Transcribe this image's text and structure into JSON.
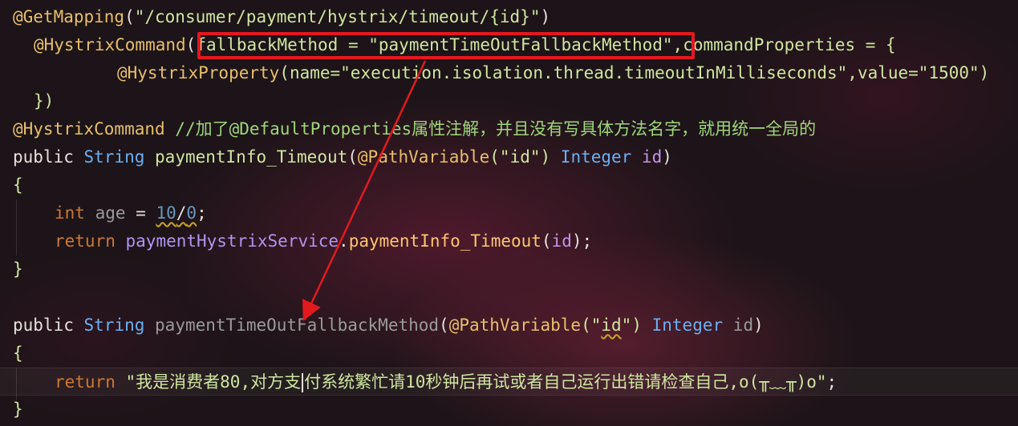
{
  "code": {
    "line1": {
      "annotation": "@GetMapping",
      "open": "(",
      "path": "\"/consumer/payment/hystrix/timeout/{id}\"",
      "close": ")"
    },
    "line2": {
      "annotation": "@HystrixCommand",
      "open": "(",
      "fallback": "fallbackMethod = \"paymentTimeOutFallbackMethod\"",
      "rest": ",commandProperties = {"
    },
    "line3": {
      "annotation": "@HystrixProperty",
      "args": "(name=\"execution.isolation.thread.timeoutInMilliseconds\",value=\"1500\")"
    },
    "line4": {
      "text": "})"
    },
    "line5": {
      "annotation": "@HystrixCommand",
      "comment": " //加了@DefaultProperties属性注解，并且没有写具体方法名字，就用统一全局的"
    },
    "line6": {
      "kw_public": "public",
      "type_string": "String",
      "method": "paymentInfo_Timeout",
      "open": "(",
      "param_ann": "@PathVariable",
      "param_str": "(\"id\")",
      "param_type": "Integer",
      "param_name": "id",
      "close": ")"
    },
    "line7": {
      "text": "{"
    },
    "line8": {
      "kw_int": "int",
      "var": "age",
      "eq": " = ",
      "num1": "10",
      "slash": "/",
      "num2": "0",
      "semi": ";"
    },
    "line9": {
      "kw_return": "return",
      "service": "paymentHystrixService",
      "dot": ".",
      "call": "paymentInfo_Timeout",
      "open": "(",
      "arg": "id",
      "close": ");"
    },
    "line10": {
      "text": "}"
    },
    "line12": {
      "kw_public": "public",
      "type_string": "String",
      "method": "paymentTimeOutFallbackMethod",
      "open": "(",
      "param_ann": "@PathVariable",
      "param_str_a": "(\"",
      "param_str_id": "id",
      "param_str_b": "\")",
      "param_type": "Integer",
      "param_name": "id",
      "close": ")"
    },
    "line13": {
      "text": "{"
    },
    "line14": {
      "kw_return": "return",
      "str_a": "\"我是消费者80,对方支",
      "str_b": "付系统繁忙请10秒钟后再试或者自己运行出错请检查自己,o(╥﹏╥)o\"",
      "semi": ";"
    },
    "line15": {
      "text": "}"
    }
  },
  "colors": {
    "highlight_box": "#e2191f",
    "arrow": "#e2191f"
  }
}
